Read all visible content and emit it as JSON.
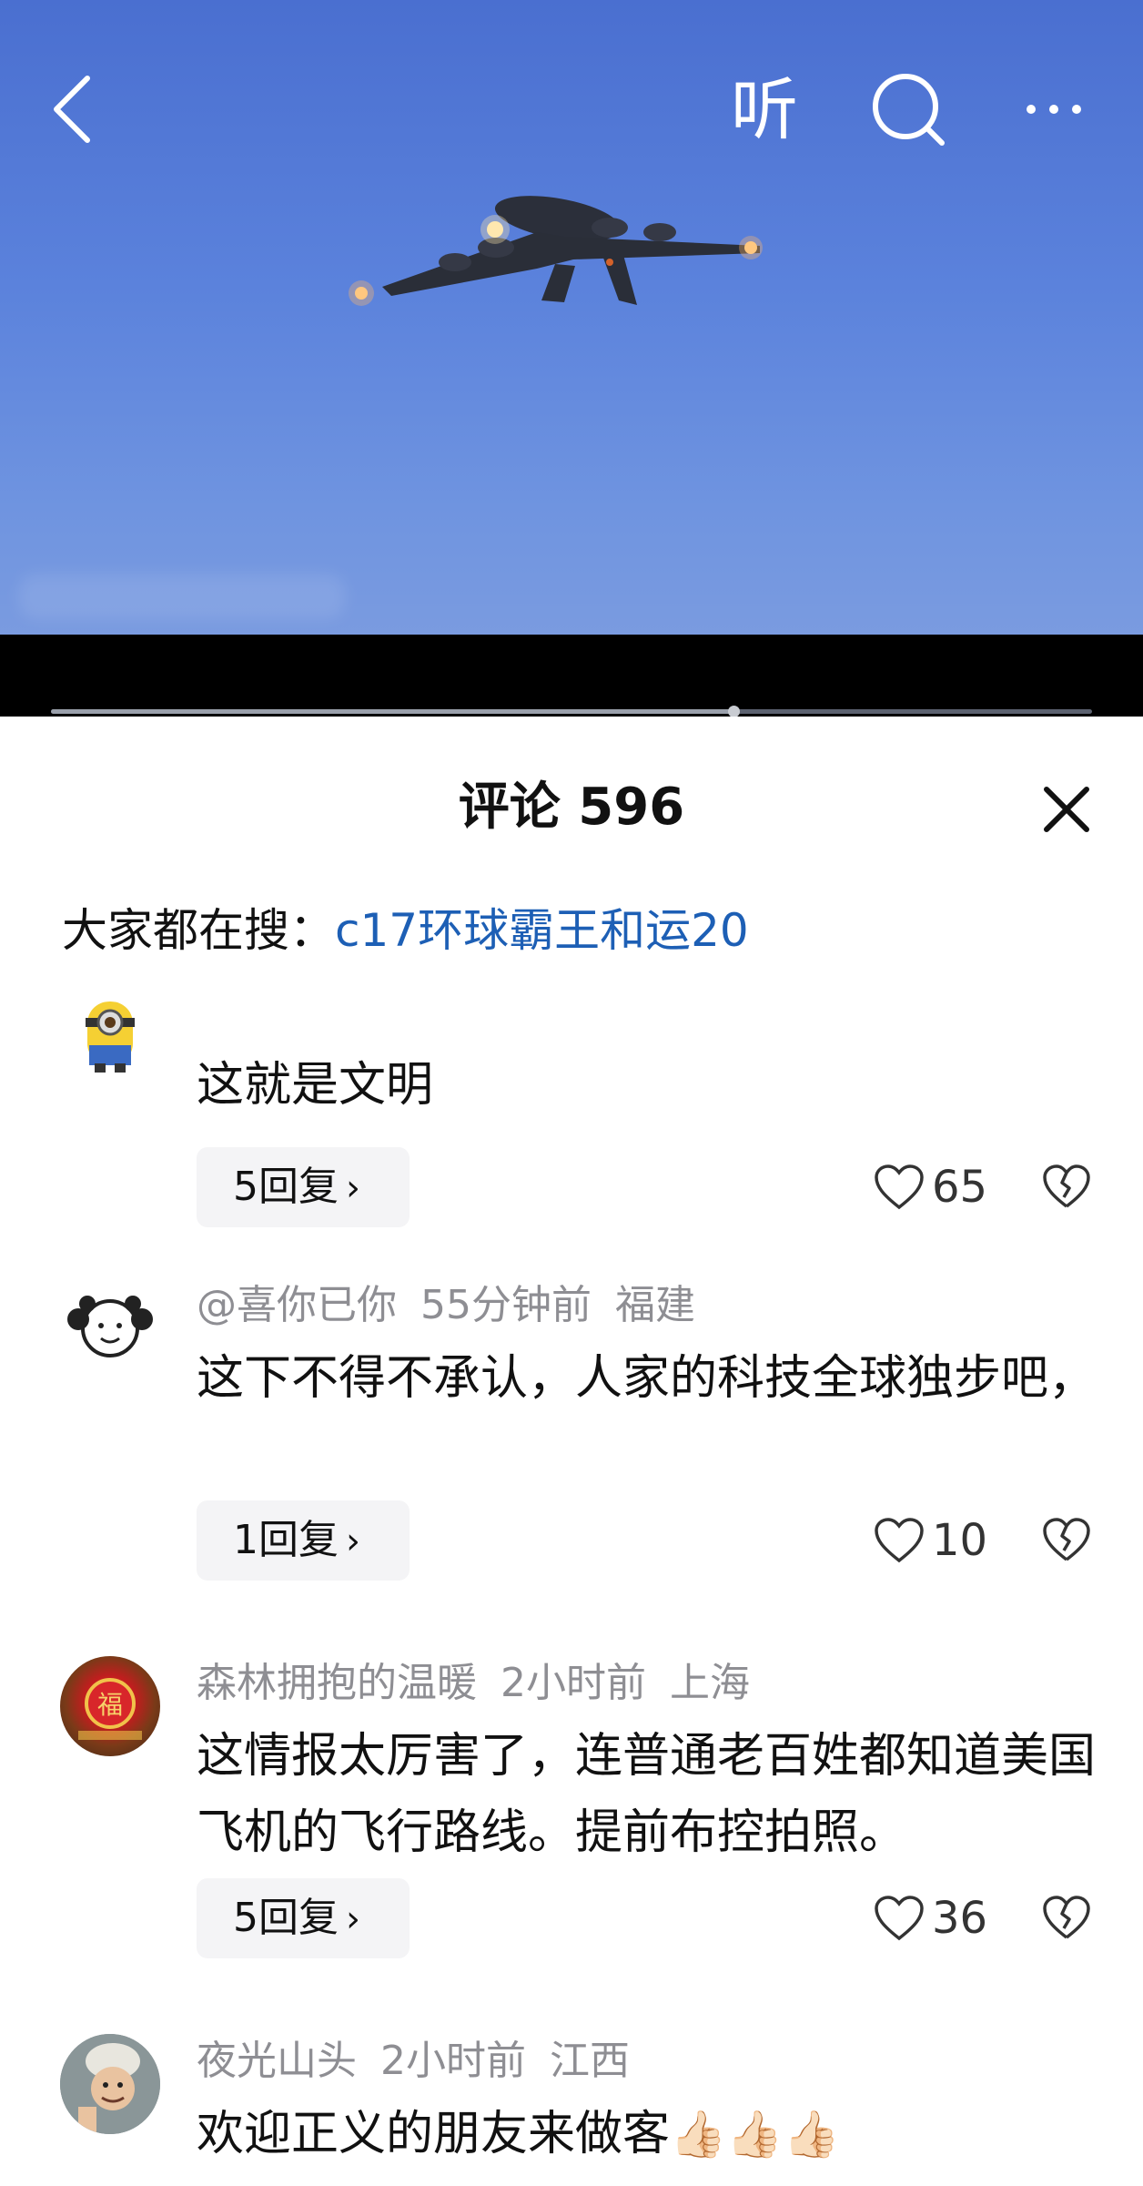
{
  "header": {
    "listen_label": "听"
  },
  "video": {
    "progress": 0.656
  },
  "comments_panel": {
    "title": "评论 596",
    "hot_search_prefix": "大家都在搜：",
    "hot_search_link": "c17环球霸王和运20",
    "comments": [
      {
        "text": "这就是文明",
        "replies": "5回复",
        "likes": "65"
      },
      {
        "user": "@喜你已你",
        "time": "55分钟前",
        "location": "福建",
        "text": "这下不得不承认，人家的科技全球独步吧，",
        "replies": "1回复",
        "likes": "10"
      },
      {
        "user": "森林拥抱的温暖",
        "time": "2小时前",
        "location": "上海",
        "text": "这情报太厉害了，连普通老百姓都知道美国飞机的飞行路线。提前布控拍照。",
        "replies": "5回复",
        "likes": "36"
      },
      {
        "user": "夜光山头",
        "time": "2小时前",
        "location": "江西",
        "text": "欢迎正义的朋友来做客",
        "emoji": "👍🏻👍🏻👍🏻"
      }
    ]
  },
  "colors": {
    "link": "#1d5fb5",
    "meta": "#8e8e93",
    "video_sky": "#5b82dc"
  },
  "icons": [
    "back-icon",
    "search-icon",
    "more-icon",
    "close-icon",
    "heart-icon",
    "broken-heart-icon",
    "chevron-right-icon"
  ]
}
